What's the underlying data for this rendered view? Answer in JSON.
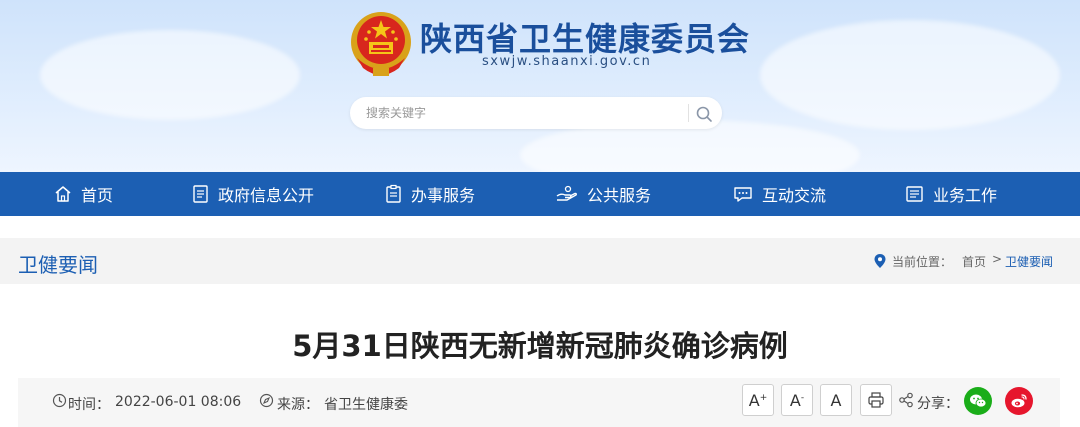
{
  "header": {
    "title": "陕西省卫生健康委员会",
    "domain": "sxwjw.shaanxi.gov.cn",
    "search_placeholder": "搜索关键字",
    "emblem_icon": "national-emblem-icon"
  },
  "nav": {
    "items": [
      {
        "label": "首页",
        "icon": "home-icon"
      },
      {
        "label": "政府信息公开",
        "icon": "document-icon"
      },
      {
        "label": "办事服务",
        "icon": "clipboard-icon"
      },
      {
        "label": "公共服务",
        "icon": "hands-icon"
      },
      {
        "label": "互动交流",
        "icon": "chat-icon"
      },
      {
        "label": "业务工作",
        "icon": "briefcase-icon"
      }
    ]
  },
  "section": {
    "title": "卫健要闻",
    "location_label": "当前位置：",
    "breadcrumb": [
      "首页",
      "卫健要闻"
    ],
    "separator": ">"
  },
  "article": {
    "title": "5月31日陕西无新增新冠肺炎确诊病例",
    "time_label": "时间：",
    "time": "2022-06-01 08:06",
    "source_label": "来源：",
    "source": "省卫生健康委",
    "font_large": "A",
    "font_large_sup": "+",
    "font_small": "A",
    "font_small_sup": "-",
    "font_default": "A",
    "share_label": "分享："
  },
  "colors": {
    "brand_blue": "#1c5fb3",
    "wechat_green": "#1aad19",
    "weibo_red": "#e6162d"
  }
}
